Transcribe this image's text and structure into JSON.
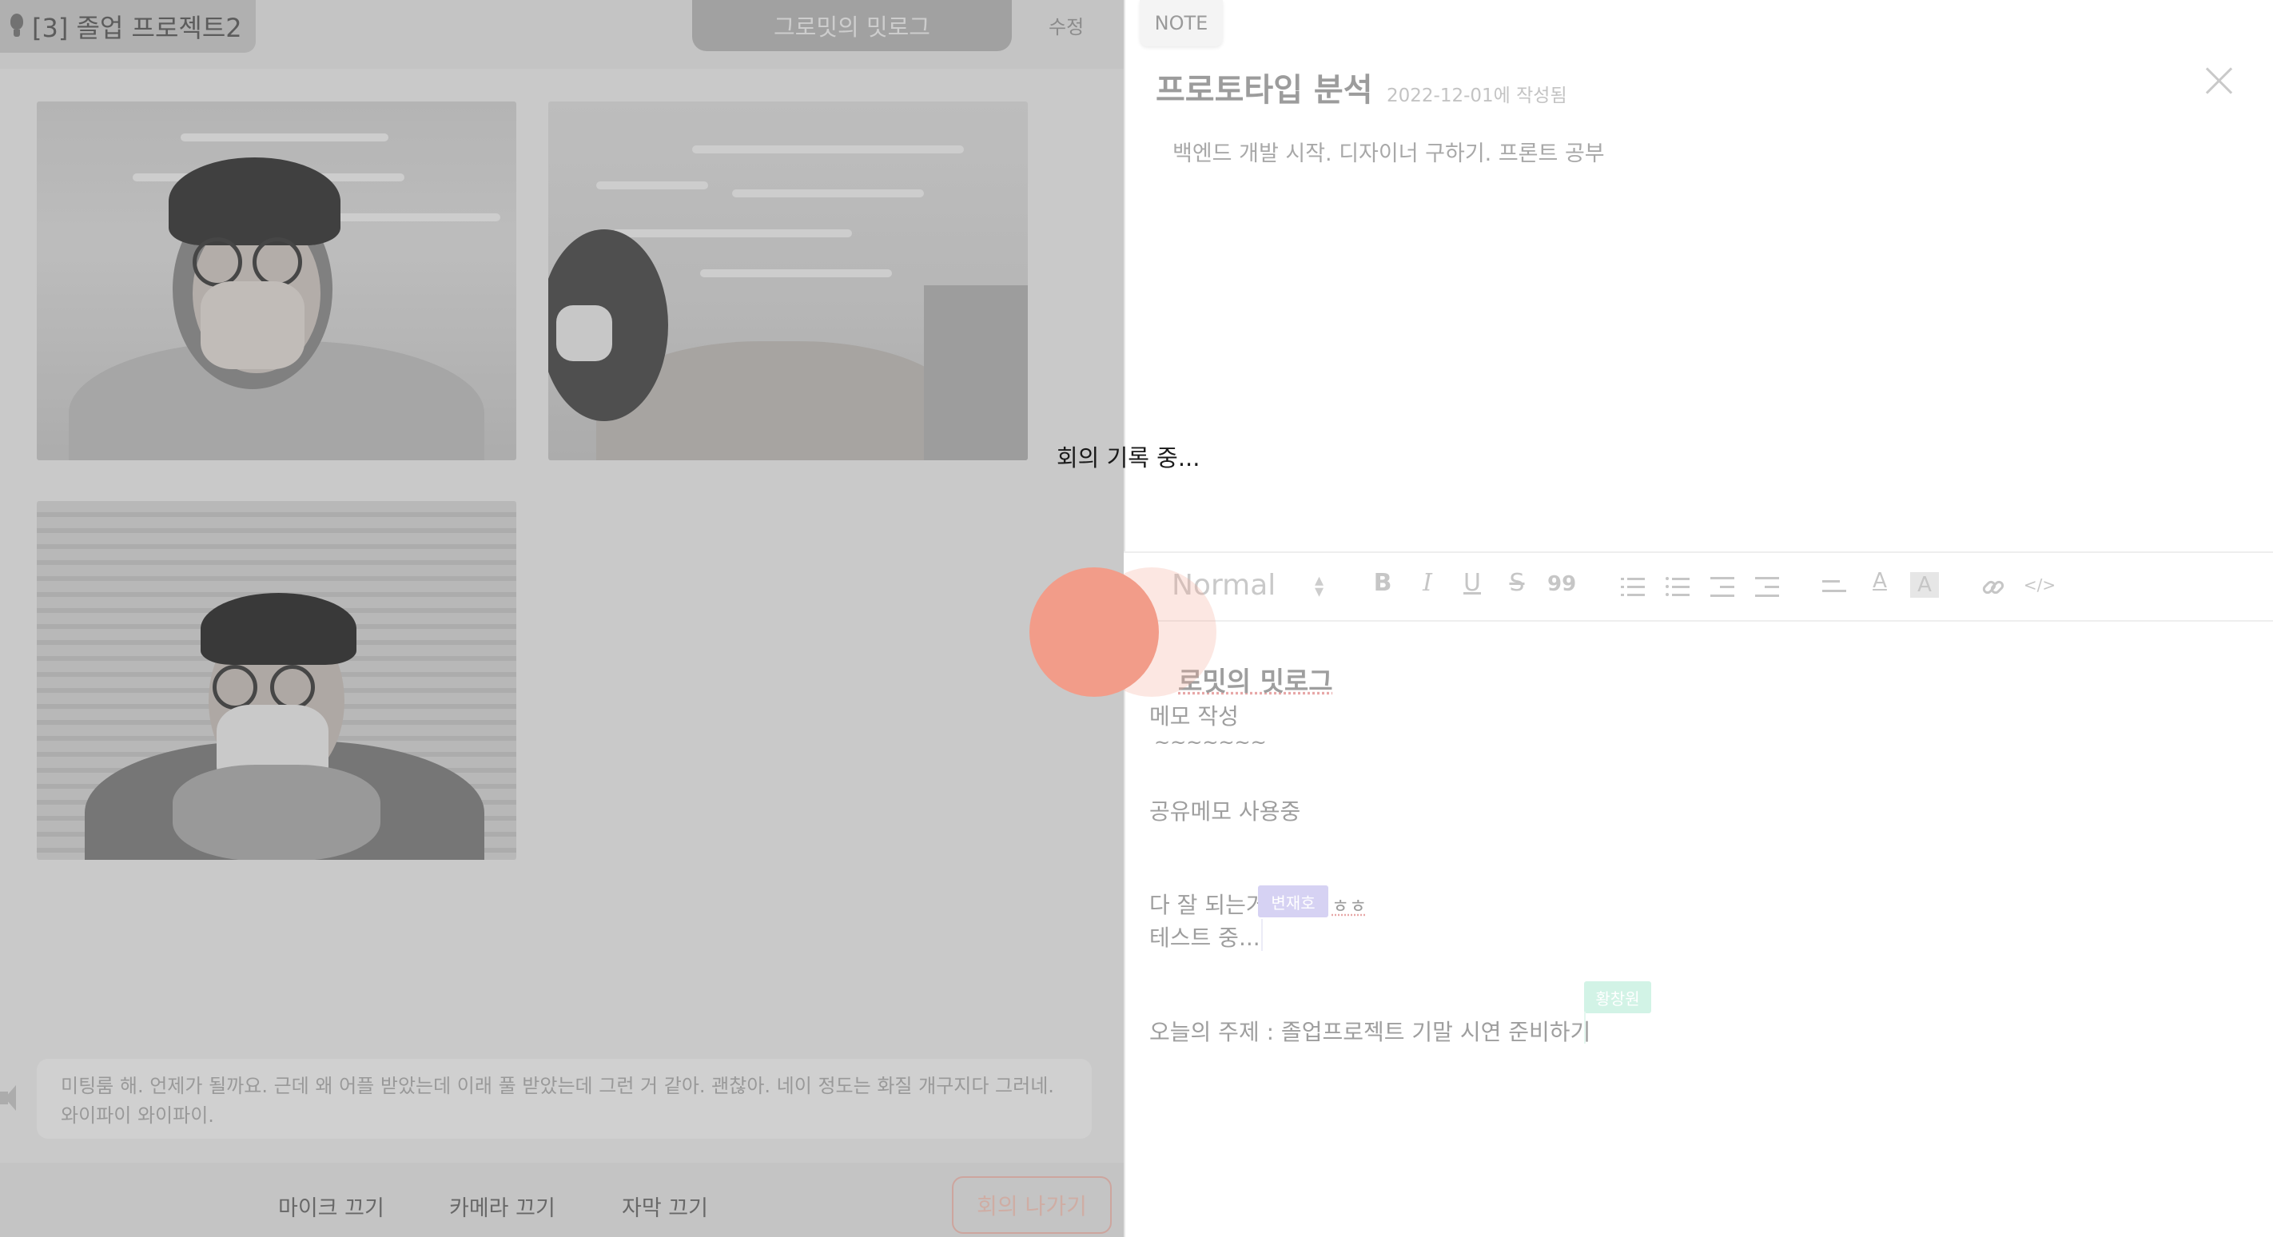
{
  "header": {
    "room_name": "[3] 졸업 프로젝트2",
    "meeting_title": "그로밋의 밋로그",
    "edit_label": "수정"
  },
  "caption": {
    "text": "미팅룸 해. 언제가 될까요. 근데 왜 어플 받았는데 이래 풀 받았는데 그런 거 같아. 괜찮아. 네이 정도는 화질 개구지다 그러네. 와이파이 와이파이."
  },
  "controls": {
    "mic_label": "마이크 끄기",
    "camera_label": "카메라 끄기",
    "subtitle_label": "자막 끄기",
    "leave_label": "회의 나가기"
  },
  "recording_status": "회의 기록 중...",
  "note": {
    "tag": "NOTE",
    "title": "프로토타입 분석",
    "date": "2022-12-01에 작성됨",
    "summary": "백엔드 개발 시작. 디자이너 구하기. 프론트 공부"
  },
  "toolbar": {
    "format_value": "Normal",
    "icons": [
      "bold-icon",
      "italic-icon",
      "underline-icon",
      "strike-icon",
      "quote-icon",
      "ordered-list-icon",
      "bullet-list-icon",
      "outdent-icon",
      "indent-icon",
      "align-icon",
      "text-color-icon",
      "highlight-icon",
      "link-icon",
      "code-icon"
    ],
    "labels": {
      "bold": "B",
      "italic": "I",
      "underline": "U",
      "strike": "S",
      "quote": "99",
      "color": "A",
      "highlight": "A",
      "code": "</>"
    }
  },
  "editor": {
    "heading_visible": "로밋의 밋로그",
    "lines": [
      "메모 작성",
      "~~~~~~~",
      "공유메모 사용중",
      "다 잘 되는거",
      "ㅎㅎ",
      "테스트 중...",
      "오늘의 주제 : 졸업프로젝트 기말 시연 준비하기"
    ],
    "cursor_users": [
      {
        "name": "변재호",
        "color": "#d6d2f3"
      },
      {
        "name": "황창원",
        "color": "#d2f3e6"
      }
    ]
  }
}
